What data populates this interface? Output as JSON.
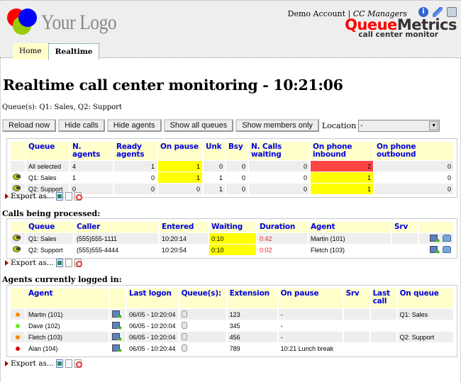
{
  "header": {
    "logo_text": "Your Logo",
    "account": "Demo Account",
    "separator": "|",
    "role": "CC Managers",
    "brand_part1": "Queue",
    "brand_part2": "Metrics",
    "brand_sub": "call center monitor",
    "icons": [
      "info-icon",
      "edit-pen-icon",
      "print-icon"
    ]
  },
  "tabs": [
    {
      "label": "Home",
      "active": false
    },
    {
      "label": "Realtime",
      "active": true
    }
  ],
  "title": "Realtime call center monitoring - 10:21:06",
  "queues_line": "Queue(s): Q1: Sales, Q2: Support",
  "buttons": {
    "reload": "Reload now",
    "hide_calls": "Hide calls",
    "hide_agents": "Hide agents",
    "show_all_queues": "Show all queues",
    "show_members_only": "Show members only"
  },
  "location": {
    "label": "Location",
    "selected": "-"
  },
  "queue_table": {
    "headers": [
      "",
      "Queue",
      "N. agents",
      "Ready agents",
      "On pause",
      "Unk",
      "Bsy",
      "N. Calls waiting",
      "On phone inbound",
      "On phone outbound"
    ],
    "rows": [
      {
        "icon": false,
        "queue": "All selected",
        "n_agents": "4",
        "ready": "1",
        "pause": "1",
        "unk": "0",
        "bsy": "0",
        "waiting": "0",
        "inbound": "2",
        "outbound": "0"
      },
      {
        "icon": true,
        "queue": "Q1: Sales",
        "n_agents": "1",
        "ready": "0",
        "pause": "1",
        "unk": "1",
        "bsy": "0",
        "waiting": "0",
        "inbound": "1",
        "outbound": "0"
      },
      {
        "icon": true,
        "queue": "Q2: Support",
        "n_agents": "0",
        "ready": "0",
        "pause": "0",
        "unk": "1",
        "bsy": "0",
        "waiting": "0",
        "inbound": "1",
        "outbound": "0"
      }
    ]
  },
  "export_label": "Export as...",
  "calls_section": {
    "title": "Calls being processed:",
    "headers": [
      "",
      "Queue",
      "Caller",
      "Entered",
      "Waiting",
      "Duration",
      "Agent",
      "Srv",
      ""
    ],
    "rows": [
      {
        "queue": "Q1: Sales",
        "caller": "(555)555-1111",
        "entered": "10:20:14",
        "waiting": "0:10",
        "duration": "0:42",
        "agent": "Martin (101)",
        "srv": ""
      },
      {
        "queue": "Q2: Support",
        "caller": "(555)555-4444",
        "entered": "10:20:54",
        "waiting": "0:10",
        "duration": "0:02",
        "agent": "Fletch (103)",
        "srv": ""
      }
    ]
  },
  "agents_section": {
    "title": "Agents currently logged in:",
    "headers": [
      "",
      "Agent",
      "",
      "Last logon",
      "Queue(s):",
      "Extension",
      "On pause",
      "Srv",
      "Last call",
      "On queue"
    ],
    "rows": [
      {
        "status_color": "#ff8800",
        "agent": "Martin (101)",
        "last_logon": "06/05 - 10:20:04",
        "extension": "123",
        "pause": "-",
        "srv": "",
        "last_call": "",
        "on_queue": "Q1: Sales"
      },
      {
        "status_color": "#66ee22",
        "agent": "Dave (102)",
        "last_logon": "06/05 - 10:20:04",
        "extension": "345",
        "pause": "-",
        "srv": "",
        "last_call": "",
        "on_queue": ""
      },
      {
        "status_color": "#ff8800",
        "agent": "Fletch (103)",
        "last_logon": "06/05 - 10:20:04",
        "extension": "456",
        "pause": "-",
        "srv": "",
        "last_call": "",
        "on_queue": "Q2: Support"
      },
      {
        "status_color": "#dd0000",
        "agent": "Alan (104)",
        "last_logon": "06/05 - 10:20:44",
        "extension": "789",
        "pause": "10:21 Lunch break",
        "srv": "",
        "last_call": "",
        "on_queue": ""
      }
    ]
  },
  "colors": {
    "header_bg": "#eeeeee",
    "table_header_bg": "#ffffcc",
    "table_header_text": "#0000dd",
    "highlight_yellow": "#ffff00",
    "highlight_red": "#ff4444",
    "duration_text": "#ee2222"
  }
}
